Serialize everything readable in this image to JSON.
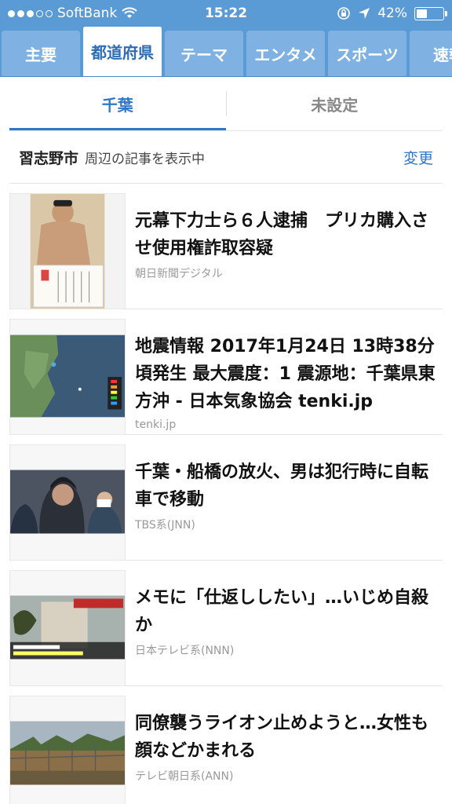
{
  "status": {
    "carrier": "SoftBank",
    "time": "15:22",
    "battery_percent": "42%",
    "battery_level": 0.42
  },
  "categories": [
    "主要",
    "都道府県",
    "テーマ",
    "エンタメ",
    "スポーツ",
    "速報"
  ],
  "active_category": 1,
  "subtabs": [
    "千葉",
    "未設定"
  ],
  "location": {
    "city": "習志野市",
    "note": "周辺の記事を表示中",
    "change_label": "変更"
  },
  "news": [
    {
      "headline": "元幕下力士ら６人逮捕　プリカ購入させ使用権詐取容疑",
      "source": "朝日新聞デジタル"
    },
    {
      "headline": "地震情報 2017年1月24日 13時38分頃発生 最大震度：1 震源地：千葉県東方沖 - 日本気象協会 tenki.jp",
      "source": "tenki.jp"
    },
    {
      "headline": "千葉・船橋の放火、男は犯行時に自転車で移動",
      "source": "TBS系(JNN)"
    },
    {
      "headline": "メモに「仕返ししたい」…いじめ自殺か",
      "source": "日本テレビ系(NNN)"
    },
    {
      "headline": "同僚襲うライオン止めようと…女性も顔などかまれる",
      "source": "テレビ朝日系(ANN)"
    }
  ]
}
